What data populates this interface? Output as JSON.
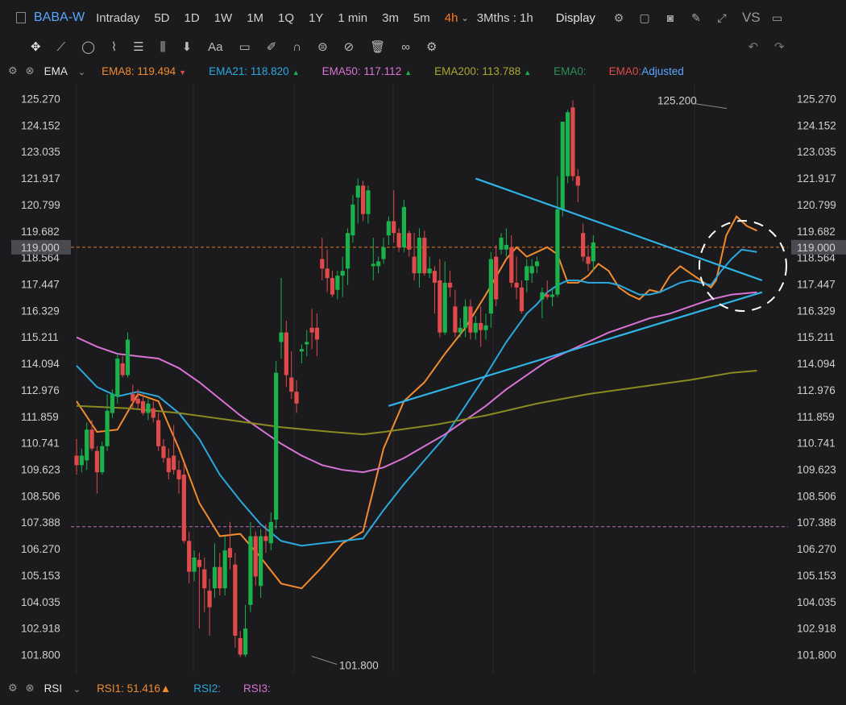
{
  "topbar": {
    "ticker": "BABA-W",
    "periods": [
      "Intraday",
      "5D",
      "1D",
      "1W",
      "1M",
      "1Q",
      "1Y",
      "1 min",
      "3m",
      "5m",
      "4h"
    ],
    "active_period": "4h",
    "range_label": "3Mths : 1h",
    "display_label": "Display",
    "vs_label": "VS"
  },
  "toolbar": {
    "text_tool": "Aa"
  },
  "indicators": {
    "main_label": "EMA",
    "ema8": "EMA8:",
    "ema8_value": "119.494",
    "ema21": "EMA21:",
    "ema21_value": "118.820",
    "ema50": "EMA50:",
    "ema50_value": "117.112",
    "ema200": "EMA200:",
    "ema200_value": "113.788",
    "ema0a": "EMA0:",
    "ema0b": "EMA0:",
    "adjusted": "Adjusted"
  },
  "rsi": {
    "label": "RSI",
    "rsi1": "RSI1:",
    "rsi1_value": "51.416",
    "rsi2": "RSI2:",
    "rsi3": "RSI3:"
  },
  "colors": {
    "ema8": "#f28b2e",
    "ema21": "#2aa8e0",
    "ema50": "#d873d6",
    "ema200": "#8a8a22",
    "up": "#19b24b",
    "down": "#e04a4a",
    "trend": "#2fb4e6"
  },
  "chart_data": {
    "type": "candlestick",
    "y_ticks": [
      125.27,
      124.152,
      123.035,
      121.917,
      120.799,
      119.682,
      118.564,
      117.447,
      116.329,
      115.211,
      114.094,
      112.976,
      111.859,
      110.741,
      109.623,
      108.506,
      107.388,
      106.27,
      105.153,
      104.035,
      102.918,
      101.8
    ],
    "ylim": [
      101.0,
      125.9
    ],
    "current_price": "119.000",
    "high_annotation": "125.200",
    "low_annotation": "101.800",
    "reference_level": 107.2,
    "candles": [
      [
        110.2,
        110.9,
        109.4,
        109.8
      ],
      [
        109.8,
        110.5,
        109.5,
        110.2
      ],
      [
        110.0,
        111.6,
        109.6,
        111.3
      ],
      [
        111.3,
        111.7,
        110.4,
        110.5
      ],
      [
        110.4,
        110.6,
        108.6,
        109.5
      ],
      [
        109.5,
        110.8,
        109.4,
        110.6
      ],
      [
        110.6,
        112.8,
        110.4,
        112.1
      ],
      [
        112.0,
        113.0,
        111.8,
        112.8
      ],
      [
        112.7,
        114.5,
        112.4,
        114.3
      ],
      [
        114.1,
        114.4,
        113.5,
        113.6
      ],
      [
        113.6,
        115.4,
        113.5,
        115.1
      ],
      [
        112.8,
        113.2,
        112.2,
        112.5
      ],
      [
        112.6,
        113.0,
        112.2,
        112.4
      ],
      [
        112.5,
        112.8,
        111.9,
        112.0
      ],
      [
        112.0,
        112.6,
        111.7,
        112.4
      ],
      [
        112.2,
        112.5,
        111.6,
        111.8
      ],
      [
        111.7,
        112.0,
        110.4,
        110.6
      ],
      [
        110.6,
        110.9,
        109.9,
        110.1
      ],
      [
        110.1,
        110.5,
        109.2,
        109.5
      ],
      [
        110.2,
        111.5,
        109.4,
        109.6
      ],
      [
        109.6,
        110.0,
        108.6,
        109.2
      ],
      [
        109.4,
        109.9,
        106.5,
        106.6
      ],
      [
        106.6,
        107.0,
        104.8,
        105.3
      ],
      [
        105.3,
        106.2,
        104.9,
        105.9
      ],
      [
        105.8,
        106.1,
        102.9,
        105.5
      ],
      [
        105.4,
        105.9,
        103.6,
        104.6
      ],
      [
        104.5,
        105.0,
        102.6,
        103.8
      ],
      [
        104.6,
        106.5,
        104.2,
        105.5
      ],
      [
        105.5,
        106.1,
        104.3,
        104.6
      ],
      [
        104.6,
        106.8,
        104.3,
        106.2
      ],
      [
        106.3,
        107.4,
        105.4,
        105.9
      ],
      [
        105.6,
        106.1,
        102.1,
        102.6
      ],
      [
        102.5,
        102.8,
        101.7,
        101.8
      ],
      [
        101.8,
        103.9,
        101.7,
        102.9
      ],
      [
        103.9,
        107.4,
        103.6,
        106.8
      ],
      [
        106.8,
        107.0,
        104.7,
        105.1
      ],
      [
        104.7,
        107.1,
        104.2,
        106.8
      ],
      [
        106.8,
        107.3,
        106.1,
        106.6
      ],
      [
        106.5,
        107.8,
        106.2,
        107.4
      ],
      [
        107.5,
        114.2,
        107.1,
        113.7
      ],
      [
        115.0,
        117.7,
        114.3,
        115.4
      ],
      [
        115.4,
        115.9,
        113.1,
        113.6
      ],
      [
        113.5,
        114.6,
        112.6,
        112.9
      ],
      [
        112.9,
        113.4,
        112.0,
        112.4
      ],
      [
        114.6,
        114.9,
        114.1,
        114.7
      ],
      [
        114.9,
        115.5,
        114.4,
        115.0
      ],
      [
        115.6,
        116.4,
        114.7,
        115.4
      ],
      [
        115.6,
        116.2,
        114.4,
        115.1
      ],
      [
        118.5,
        119.4,
        117.6,
        118.1
      ],
      [
        118.1,
        118.9,
        117.1,
        117.7
      ],
      [
        117.7,
        118.0,
        116.9,
        117.0
      ],
      [
        117.2,
        118.0,
        116.8,
        117.8
      ],
      [
        117.8,
        118.6,
        116.9,
        118.0
      ],
      [
        118.1,
        119.8,
        117.4,
        119.6
      ],
      [
        119.5,
        121.2,
        119.2,
        120.8
      ],
      [
        121.1,
        121.9,
        120.0,
        121.6
      ],
      [
        121.6,
        121.8,
        120.1,
        120.4
      ],
      [
        120.4,
        121.6,
        120.0,
        121.4
      ],
      [
        118.2,
        119.4,
        117.6,
        118.3
      ],
      [
        118.2,
        118.6,
        117.9,
        118.4
      ],
      [
        118.5,
        119.4,
        118.3,
        119.0
      ],
      [
        119.5,
        120.3,
        119.1,
        120.1
      ],
      [
        120.1,
        121.4,
        119.2,
        119.6
      ],
      [
        119.6,
        119.8,
        118.8,
        119.0
      ],
      [
        119.0,
        121.0,
        118.8,
        120.7
      ],
      [
        119.6,
        119.7,
        118.6,
        118.9
      ],
      [
        118.6,
        119.6,
        117.6,
        117.9
      ],
      [
        117.9,
        119.8,
        117.3,
        119.4
      ],
      [
        119.4,
        119.7,
        117.8,
        117.9
      ],
      [
        117.9,
        118.6,
        117.7,
        118.1
      ],
      [
        118.0,
        118.2,
        116.2,
        117.5
      ],
      [
        117.6,
        118.5,
        115.2,
        115.4
      ],
      [
        115.4,
        118.4,
        115.3,
        117.5
      ],
      [
        117.5,
        118.0,
        116.9,
        117.3
      ],
      [
        116.5,
        117.2,
        115.2,
        115.4
      ],
      [
        115.4,
        116.0,
        115.2,
        115.6
      ],
      [
        115.6,
        116.8,
        115.2,
        116.5
      ],
      [
        116.5,
        116.8,
        115.1,
        115.4
      ],
      [
        115.4,
        116.1,
        115.1,
        115.8
      ],
      [
        115.8,
        116.5,
        114.8,
        115.5
      ],
      [
        115.5,
        116.2,
        115.1,
        115.7
      ],
      [
        116.2,
        118.8,
        115.6,
        118.5
      ],
      [
        118.6,
        119.1,
        116.5,
        116.8
      ],
      [
        118.9,
        119.6,
        118.7,
        119.4
      ],
      [
        118.9,
        119.8,
        118.6,
        119.1
      ],
      [
        119.0,
        119.5,
        117.3,
        117.5
      ],
      [
        117.5,
        118.6,
        116.8,
        117.3
      ],
      [
        117.3,
        117.6,
        116.2,
        116.3
      ],
      [
        117.6,
        118.5,
        117.1,
        118.2
      ],
      [
        117.9,
        118.5,
        117.5,
        118.2
      ],
      [
        118.2,
        118.6,
        117.9,
        118.4
      ],
      [
        116.8,
        117.3,
        116.0,
        117.1
      ],
      [
        117.0,
        117.6,
        116.8,
        116.9
      ],
      [
        116.9,
        117.3,
        116.5,
        117.0
      ],
      [
        117.0,
        122.0,
        116.9,
        120.6
      ],
      [
        120.6,
        122.5,
        120.3,
        124.3
      ],
      [
        122.0,
        124.8,
        121.7,
        124.7
      ],
      [
        124.9,
        125.2,
        121.8,
        122.0
      ],
      [
        122.0,
        122.3,
        120.9,
        121.6
      ],
      [
        119.6,
        120.0,
        118.4,
        118.6
      ],
      [
        118.6,
        119.1,
        118.0,
        118.3
      ],
      [
        118.4,
        119.5,
        118.0,
        119.2
      ]
    ],
    "series": [
      {
        "name": "EMA8",
        "color": "#f28b2e",
        "points": [
          [
            0,
            112.5
          ],
          [
            4,
            111.2
          ],
          [
            8,
            111.3
          ],
          [
            12,
            112.8
          ],
          [
            16,
            112.5
          ],
          [
            20,
            110.5
          ],
          [
            24,
            108.2
          ],
          [
            28,
            106.8
          ],
          [
            32,
            106.9
          ],
          [
            36,
            105.9
          ],
          [
            40,
            104.8
          ],
          [
            44,
            104.6
          ],
          [
            48,
            105.5
          ],
          [
            52,
            106.5
          ],
          [
            56,
            107.0
          ],
          [
            60,
            110.5
          ],
          [
            64,
            112.5
          ],
          [
            68,
            113.3
          ],
          [
            72,
            114.5
          ],
          [
            76,
            115.6
          ],
          [
            80,
            117.0
          ],
          [
            84,
            118.5
          ],
          [
            86,
            119.0
          ],
          [
            88,
            118.6
          ],
          [
            90,
            118.8
          ],
          [
            92,
            119.0
          ],
          [
            94,
            118.7
          ],
          [
            96,
            117.5
          ],
          [
            98,
            117.5
          ],
          [
            100,
            117.8
          ],
          [
            102,
            118.3
          ],
          [
            104,
            118.0
          ],
          [
            106,
            117.3
          ],
          [
            108,
            117.0
          ],
          [
            110,
            116.8
          ],
          [
            112,
            117.2
          ],
          [
            114,
            117.1
          ],
          [
            116,
            117.8
          ],
          [
            118,
            118.2
          ],
          [
            120,
            117.9
          ],
          [
            122,
            117.6
          ],
          [
            124,
            117.3
          ],
          [
            125,
            117.6
          ],
          [
            127,
            119.5
          ],
          [
            129,
            120.3
          ],
          [
            131,
            119.9
          ],
          [
            133,
            119.7
          ]
        ]
      },
      {
        "name": "EMA21",
        "color": "#2aa8e0",
        "points": [
          [
            0,
            114.0
          ],
          [
            4,
            113.1
          ],
          [
            8,
            112.7
          ],
          [
            12,
            112.9
          ],
          [
            16,
            112.7
          ],
          [
            20,
            112.0
          ],
          [
            24,
            110.9
          ],
          [
            28,
            109.4
          ],
          [
            32,
            108.3
          ],
          [
            36,
            107.3
          ],
          [
            40,
            106.6
          ],
          [
            44,
            106.4
          ],
          [
            48,
            106.5
          ],
          [
            52,
            106.6
          ],
          [
            56,
            106.7
          ],
          [
            60,
            107.9
          ],
          [
            64,
            109.0
          ],
          [
            68,
            110.0
          ],
          [
            72,
            111.0
          ],
          [
            76,
            112.3
          ],
          [
            80,
            113.6
          ],
          [
            84,
            115.0
          ],
          [
            86,
            115.6
          ],
          [
            88,
            116.2
          ],
          [
            90,
            116.6
          ],
          [
            92,
            117.1
          ],
          [
            94,
            117.4
          ],
          [
            96,
            117.6
          ],
          [
            98,
            117.6
          ],
          [
            100,
            117.5
          ],
          [
            102,
            117.5
          ],
          [
            104,
            117.5
          ],
          [
            106,
            117.4
          ],
          [
            108,
            117.2
          ],
          [
            110,
            117.0
          ],
          [
            112,
            117.0
          ],
          [
            114,
            117.1
          ],
          [
            116,
            117.3
          ],
          [
            118,
            117.5
          ],
          [
            120,
            117.6
          ],
          [
            122,
            117.5
          ],
          [
            124,
            117.4
          ],
          [
            126,
            118.0
          ],
          [
            128,
            118.5
          ],
          [
            130,
            118.9
          ],
          [
            133,
            118.8
          ]
        ]
      },
      {
        "name": "EMA50",
        "color": "#d873d6",
        "points": [
          [
            0,
            115.2
          ],
          [
            4,
            114.8
          ],
          [
            8,
            114.5
          ],
          [
            12,
            114.4
          ],
          [
            16,
            114.3
          ],
          [
            20,
            113.9
          ],
          [
            24,
            113.3
          ],
          [
            28,
            112.6
          ],
          [
            32,
            111.9
          ],
          [
            36,
            111.3
          ],
          [
            40,
            110.7
          ],
          [
            44,
            110.2
          ],
          [
            48,
            109.8
          ],
          [
            52,
            109.6
          ],
          [
            56,
            109.5
          ],
          [
            60,
            109.7
          ],
          [
            64,
            110.1
          ],
          [
            68,
            110.6
          ],
          [
            72,
            111.1
          ],
          [
            76,
            111.7
          ],
          [
            80,
            112.3
          ],
          [
            84,
            113.0
          ],
          [
            88,
            113.6
          ],
          [
            92,
            114.2
          ],
          [
            96,
            114.6
          ],
          [
            100,
            115.0
          ],
          [
            104,
            115.4
          ],
          [
            108,
            115.7
          ],
          [
            112,
            116.0
          ],
          [
            116,
            116.2
          ],
          [
            120,
            116.5
          ],
          [
            124,
            116.8
          ],
          [
            128,
            117.0
          ],
          [
            133,
            117.1
          ]
        ]
      },
      {
        "name": "EMA200",
        "color": "#8a8a22",
        "points": [
          [
            0,
            112.3
          ],
          [
            10,
            112.2
          ],
          [
            20,
            112.0
          ],
          [
            30,
            111.7
          ],
          [
            40,
            111.4
          ],
          [
            50,
            111.2
          ],
          [
            56,
            111.1
          ],
          [
            60,
            111.2
          ],
          [
            70,
            111.5
          ],
          [
            80,
            111.9
          ],
          [
            90,
            112.4
          ],
          [
            100,
            112.8
          ],
          [
            110,
            113.1
          ],
          [
            120,
            113.4
          ],
          [
            128,
            113.7
          ],
          [
            133,
            113.79
          ]
        ]
      }
    ],
    "trendlines": [
      {
        "from": [
          61,
          112.3
        ],
        "to": [
          134,
          117.1
        ]
      },
      {
        "from": [
          78,
          121.9
        ],
        "to": [
          134,
          117.6
        ]
      }
    ]
  }
}
